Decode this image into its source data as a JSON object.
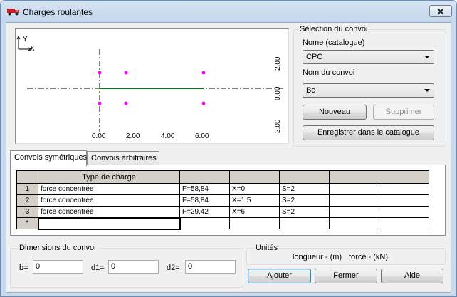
{
  "window": {
    "title": "Charges roulantes"
  },
  "preview": {
    "axis_y": "Y",
    "axis_x": "X",
    "x_ticks": [
      "0.00",
      "2.00",
      "4.00",
      "6.00"
    ],
    "y_ticks": [
      "2.00",
      "0.00",
      "2.00"
    ]
  },
  "convoy_selection": {
    "legend": "Sélection du convoi",
    "name_catalog_label": "Nome (catalogue)",
    "name_catalog_value": "CPC",
    "convoy_name_label": "Nom du convoi",
    "convoy_name_value": "Bc",
    "new_button": "Nouveau",
    "delete_button": "Supprimer",
    "save_button": "Enregistrer dans le catalogue"
  },
  "tabs": [
    {
      "label": "Convois symétriques"
    },
    {
      "label": "Convois arbitraires"
    }
  ],
  "grid": {
    "headers": [
      "",
      "Type de charge",
      "",
      "",
      "",
      "",
      ""
    ],
    "rows": [
      {
        "num": "1",
        "type": "force concentrée",
        "c1": "F=58,84",
        "c2": "X=0",
        "c3": "S=2",
        "c4": "",
        "c5": ""
      },
      {
        "num": "2",
        "type": "force concentrée",
        "c1": "F=58,84",
        "c2": "X=1,5",
        "c3": "S=2",
        "c4": "",
        "c5": ""
      },
      {
        "num": "3",
        "type": "force concentrée",
        "c1": "F=29,42",
        "c2": "X=6",
        "c3": "S=2",
        "c4": "",
        "c5": ""
      },
      {
        "num": "*",
        "type": "",
        "c1": "",
        "c2": "",
        "c3": "",
        "c4": "",
        "c5": ""
      }
    ]
  },
  "dimensions": {
    "legend": "Dimensions du convoi",
    "b_label": "b=",
    "b_value": "0",
    "d1_label": "d1=",
    "d1_value": "0",
    "d2_label": "d2=",
    "d2_value": "0"
  },
  "units": {
    "legend": "Unités",
    "length": "longueur - (m)",
    "force": "force - (kN)"
  },
  "buttons": {
    "add": "Ajouter",
    "close": "Fermer",
    "help": "Aide"
  },
  "colors": {
    "load_marker": "#ff00ff",
    "axle_line": "#1f6b1f"
  }
}
